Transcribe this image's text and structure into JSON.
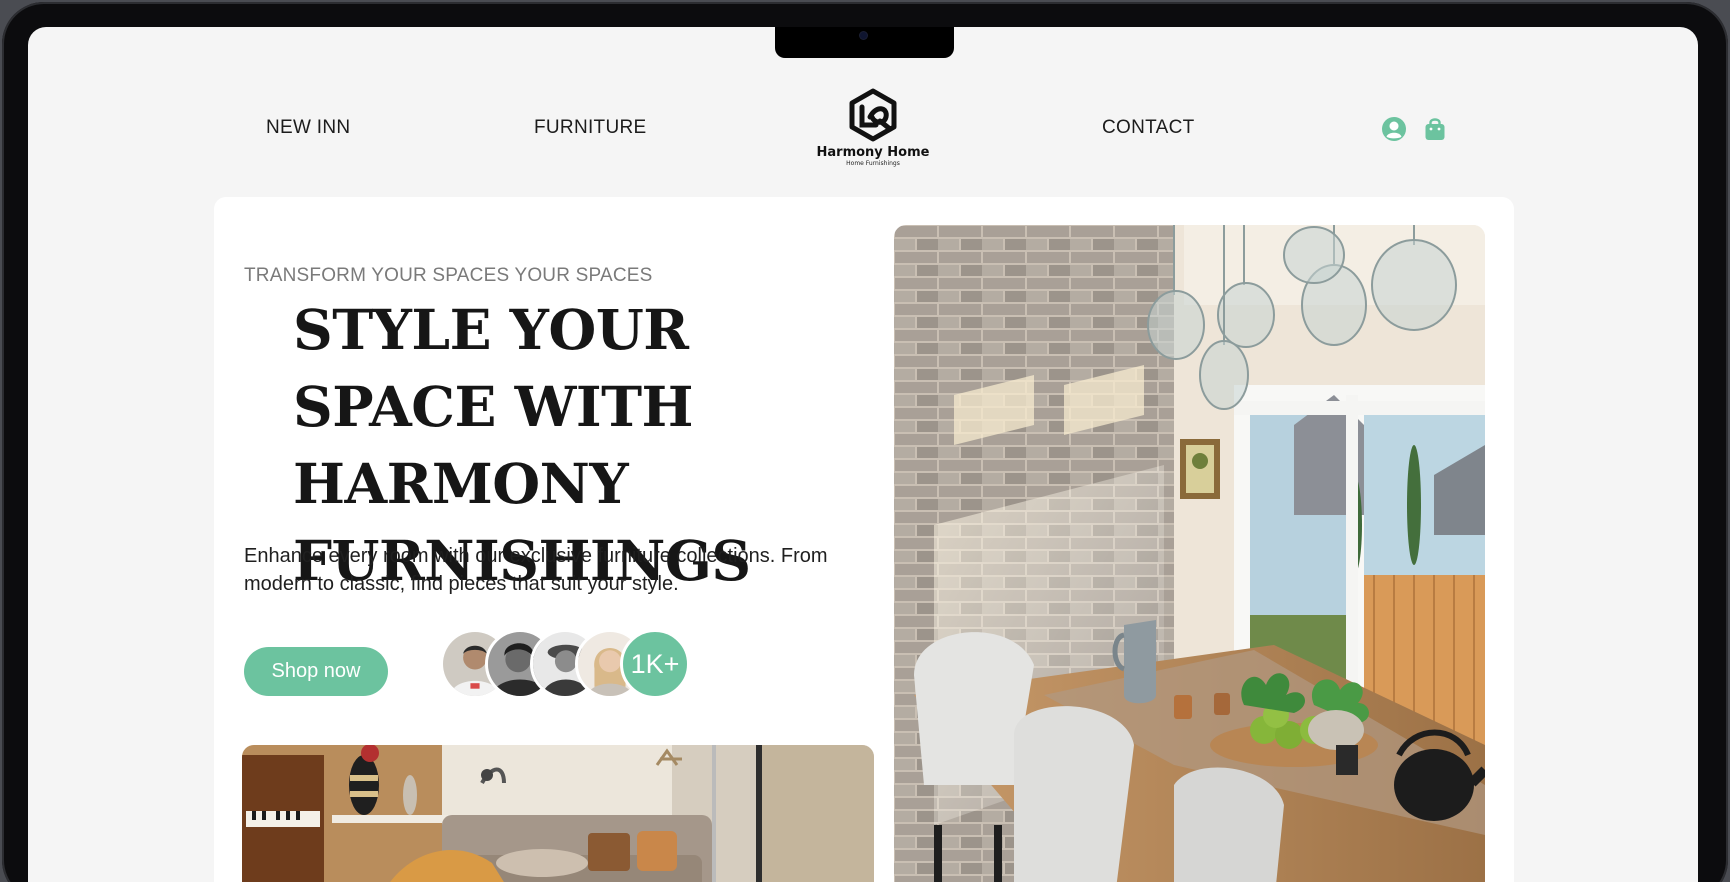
{
  "nav": {
    "links": [
      "NEW INN",
      "FURNITURE",
      "CONTACT"
    ],
    "logo": {
      "name": "Harmony Home",
      "tagline": "Home Furnishings"
    },
    "icons": [
      "user-icon",
      "shopping-bag-icon"
    ]
  },
  "hero": {
    "eyebrow": "TRANSFORM YOUR SPACES YOUR SPACES",
    "headline": "STYLE YOUR SPACE WITH HARMONY FURNISHINGS",
    "description": "Enhance every room with our exclusive furniture collections. From modern to classic, find pieces that suit your style.",
    "cta_label": "Shop now",
    "customer_count": "1K+"
  },
  "colors": {
    "accent": "#6cc39f",
    "background": "#f5f5f5",
    "card": "#ffffff",
    "text": "#161616"
  }
}
